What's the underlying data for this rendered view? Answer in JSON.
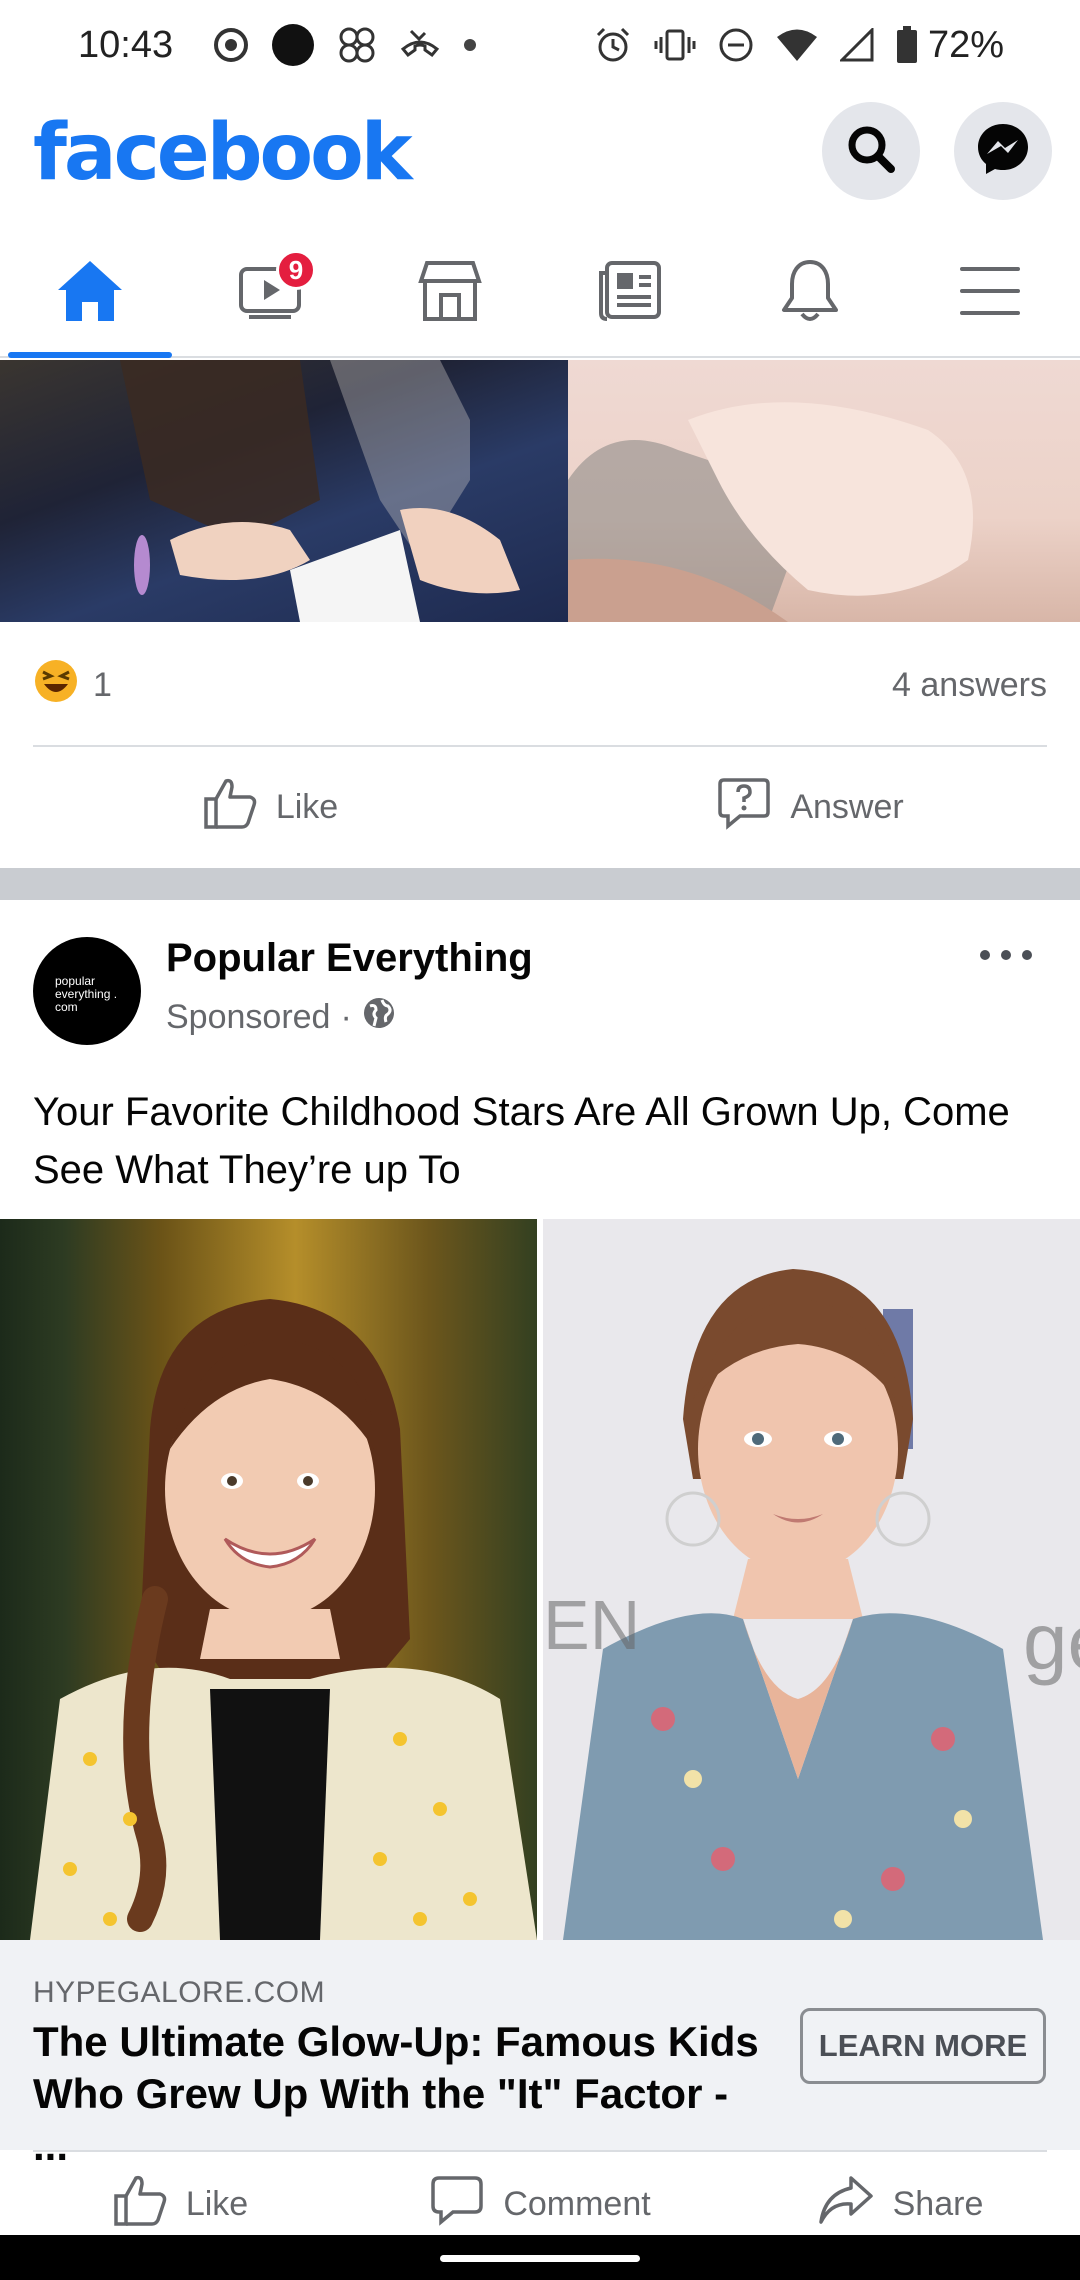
{
  "status_bar": {
    "time": "10:43",
    "battery": "72%"
  },
  "header": {
    "logo": "facebook",
    "icons": [
      "search-icon",
      "messenger-icon"
    ]
  },
  "tabs": [
    {
      "name": "home",
      "icon": "home-icon",
      "active": true
    },
    {
      "name": "watch",
      "icon": "video-icon",
      "badge": "9"
    },
    {
      "name": "marketplace",
      "icon": "store-icon"
    },
    {
      "name": "news",
      "icon": "news-icon"
    },
    {
      "name": "notifications",
      "icon": "bell-icon"
    },
    {
      "name": "menu",
      "icon": "menu-icon"
    }
  ],
  "post1": {
    "reaction_count": "1",
    "answers": "4 answers",
    "like_label": "Like",
    "answer_label": "Answer"
  },
  "post2": {
    "avatar_text": "popular everything . com",
    "author": "Popular Everything",
    "sponsored": "Sponsored",
    "text": "Your Favorite Childhood Stars Are All Grown Up, Come See What They’re up To",
    "link": {
      "domain": "HYPEGALORE.COM",
      "title": "The Ultimate Glow-Up: Famous Kids Who Grew Up With the \"It\" Factor - ...",
      "cta": "LEARN MORE"
    },
    "actions": {
      "like": "Like",
      "comment": "Comment",
      "share": "Share"
    }
  },
  "colors": {
    "brand": "#1877f2",
    "badge": "#e41e3f",
    "muted": "#65676b"
  }
}
